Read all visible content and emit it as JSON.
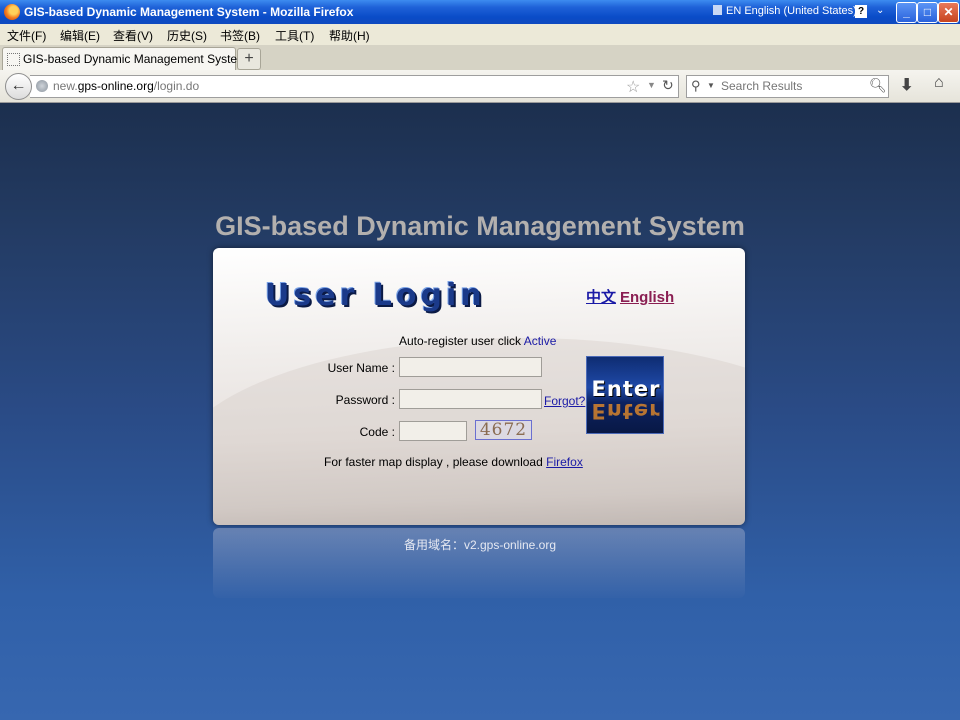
{
  "window": {
    "title": "GIS-based Dynamic Management System - Mozilla Firefox",
    "language": "EN English (United States)",
    "help_label": "?",
    "options_label": "⌄",
    "minimize": "_",
    "maximize": "□",
    "close": "✕"
  },
  "menu": [
    "文件(F)",
    "编辑(E)",
    "查看(V)",
    "历史(S)",
    "书签(B)",
    "工具(T)",
    "帮助(H)"
  ],
  "tab": {
    "label": "GIS-based Dynamic Management System",
    "new_tab": "+"
  },
  "nav": {
    "back": "←",
    "url_prefix": "new.",
    "url_domain": "gps-online.org",
    "url_path": "/login.do",
    "search_placeholder": "Search Results",
    "star": "☆",
    "dropdown": "▼",
    "reload": "↻",
    "search_icon": "⚲",
    "download": "⬇",
    "home": "⌂"
  },
  "page": {
    "title": "GIS-based Dynamic Management System",
    "login_heading": "User Login",
    "lang_zh": "中文",
    "lang_en": "English",
    "autoreg_text": "Auto-register user click",
    "autoreg_link": "Active",
    "username_label": "User Name :",
    "password_label": "Password :",
    "code_label": "Code :",
    "forgot_link": "Forgot?",
    "captcha": "4672",
    "enter_button": "Enter",
    "download_text": "For faster map display , please download",
    "download_link": "Firefox",
    "alt_domain": "备用域名：v2.gps-online.org"
  },
  "colors": {
    "titlebar": "#0a4cc8",
    "link": "#1a1aa6",
    "english_link": "#8a1e52",
    "page_bg": "#2a4b86"
  }
}
